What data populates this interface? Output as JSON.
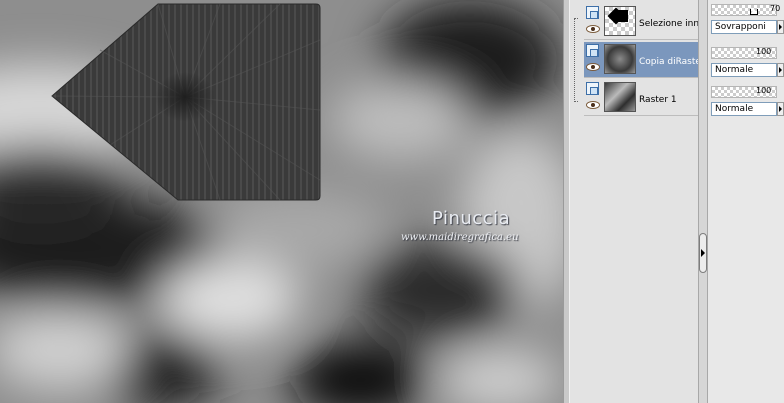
{
  "canvas": {
    "watermark_name": "Pinuccia",
    "watermark_url": "www.maidiregrafica.eu"
  },
  "layers": [
    {
      "name": "Selezione innal",
      "selected": false,
      "thumbnail": "checker-with-black-shape"
    },
    {
      "name": "Copia diRaster",
      "selected": true,
      "thumbnail": "gray-radial"
    },
    {
      "name": "Raster 1",
      "selected": false,
      "thumbnail": "gray-radial"
    }
  ],
  "layer_properties": [
    {
      "opacity": "70",
      "opacity_level": 70,
      "blend_mode": "Sovrapponi"
    },
    {
      "opacity": "100",
      "opacity_level": 100,
      "blend_mode": "Normale"
    },
    {
      "opacity": "100",
      "opacity_level": 100,
      "blend_mode": "Normale"
    }
  ],
  "colors": {
    "selection_highlight": "#7b97bd",
    "panel_bg": "#e3e3e3"
  },
  "icons": [
    "layer-type-icon",
    "eye-icon",
    "collapse-arrow-icon",
    "dropdown-arrow-icon"
  ]
}
